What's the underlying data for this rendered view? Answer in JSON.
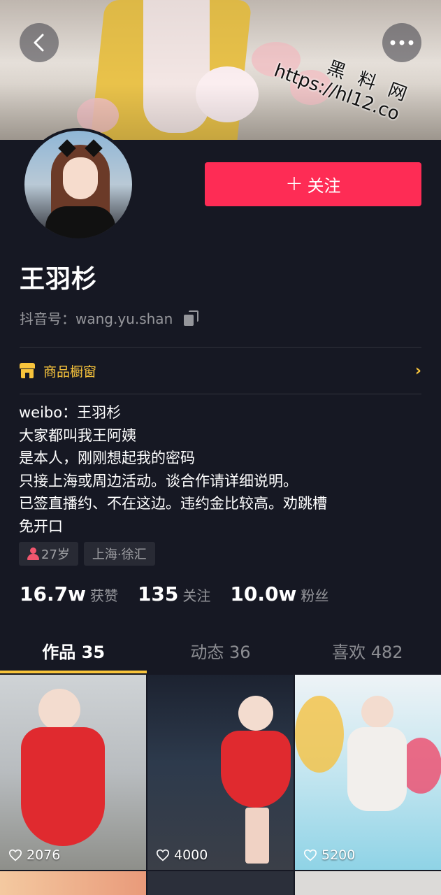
{
  "header": {
    "back_icon": "chevron-left-icon",
    "more_icon": "more-dots-icon",
    "watermark_line1": "黑 料 网",
    "watermark_line2": "https://hl12.co"
  },
  "profile": {
    "follow_label": "关注",
    "name": "王羽杉",
    "douyin_id_label": "抖音号：",
    "douyin_id": "wang.yu.shan",
    "shop_label": "商品橱窗",
    "bio": "weibo：王羽杉\n大家都叫我王阿姨\n是本人，刚刚想起我的密码\n只接上海或周边活动。谈合作请详细说明。\n已签直播约、不在这边。违约金比较高。劝跳槽\n免开口",
    "tags": {
      "age": "27岁",
      "location": "上海·徐汇"
    },
    "stats": {
      "likes_num": "16.7w",
      "likes_label": "获赞",
      "following_num": "135",
      "following_label": "关注",
      "followers_num": "10.0w",
      "followers_label": "粉丝"
    }
  },
  "tabs": [
    {
      "label": "作品 35",
      "active": true
    },
    {
      "label": "动态 36",
      "active": false
    },
    {
      "label": "喜欢 482",
      "active": false
    }
  ],
  "videos": [
    {
      "likes": "2076"
    },
    {
      "likes": "4000"
    },
    {
      "likes": "5200"
    }
  ],
  "colors": {
    "background": "#161823",
    "follow": "#fe2c55",
    "accent": "#f8c43c"
  }
}
